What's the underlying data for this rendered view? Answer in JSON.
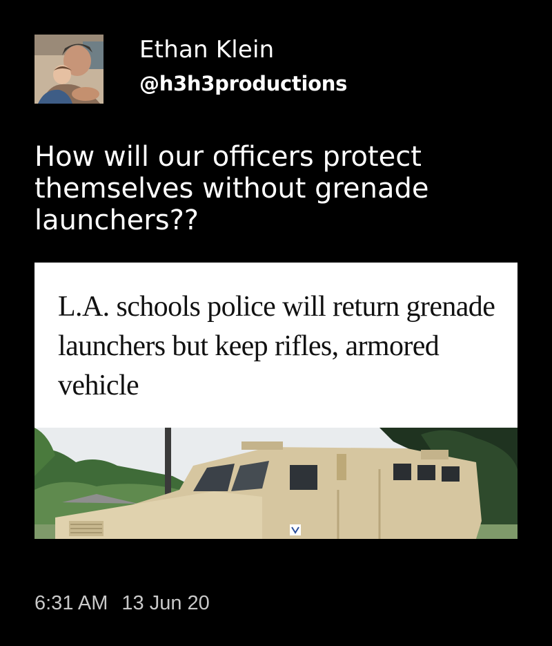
{
  "author": {
    "name": "Ethan Klein",
    "handle": "@h3h3productions"
  },
  "tweet": {
    "text": "How will our officers protect themselves without grenade launchers??"
  },
  "media": {
    "headline": "L.A. schools police will return grenade launchers but keep rifles, armored vehicle",
    "photo": "armored-vehicle-photo"
  },
  "timestamp": {
    "time": "6:31 AM",
    "date": "13 Jun 20"
  },
  "colors": {
    "background": "#000000",
    "text": "#ffffff",
    "timestamp": "#c9c9c9",
    "card": "#ffffff",
    "vehicle": "#d8c9a3"
  }
}
